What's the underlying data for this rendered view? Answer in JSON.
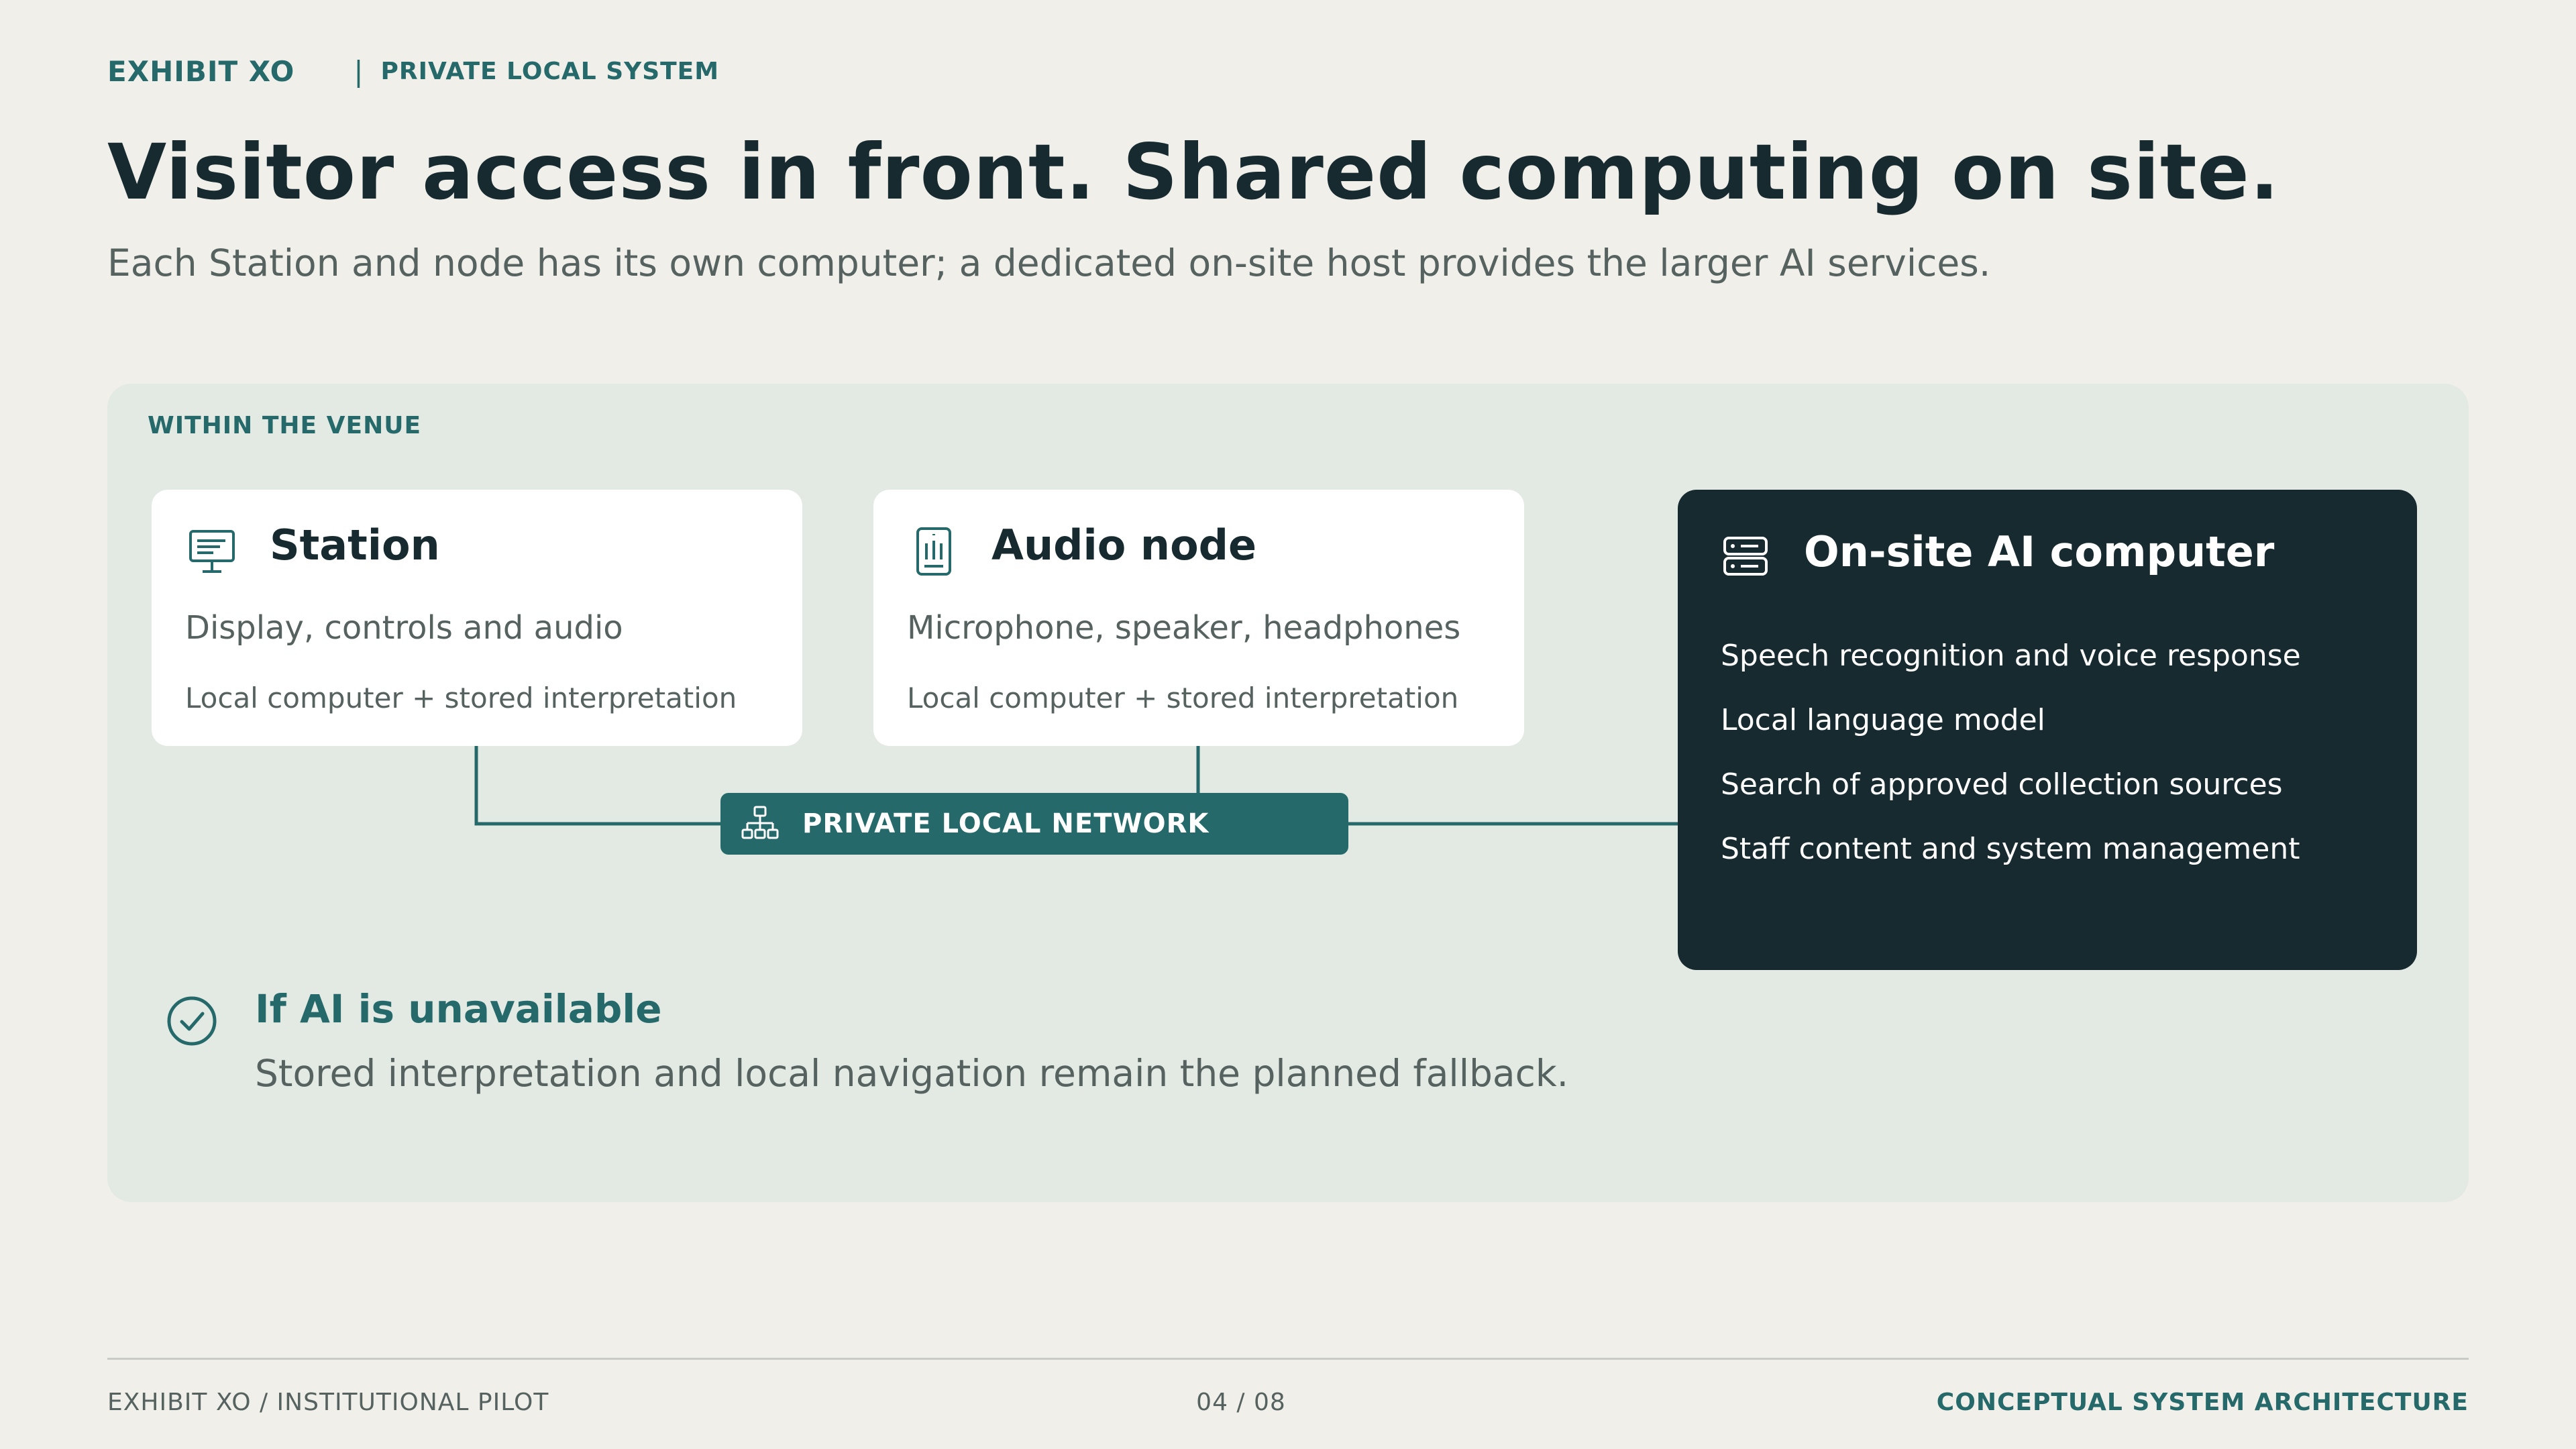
{
  "header": {
    "brand": "EXHIBIT XO",
    "separator": "|",
    "section": "PRIVATE LOCAL SYSTEM",
    "title": "Visitor access in front. Shared computing on site.",
    "subtitle": "Each Station and node has its own computer; a dedicated on-site host provides the larger AI services."
  },
  "venue": {
    "label": "WITHIN THE VENUE",
    "station": {
      "icon": "monitor-icon",
      "title": "Station",
      "description": "Display, controls and audio",
      "note": "Local computer + stored interpretation"
    },
    "audio_node": {
      "icon": "audio-device-icon",
      "title": "Audio node",
      "description": "Microphone, speaker, headphones",
      "note": "Local computer + stored interpretation"
    },
    "ai_computer": {
      "icon": "server-icon",
      "title": "On-site AI computer",
      "items": [
        "Speech recognition and voice response",
        "Local language model",
        "Search of approved collection sources",
        "Staff content and system management"
      ]
    },
    "network": {
      "icon": "network-icon",
      "label": "PRIVATE LOCAL NETWORK"
    },
    "fallback": {
      "icon": "check-circle-icon",
      "title": "If AI is unavailable",
      "text": "Stored interpretation and local navigation remain the planned fallback."
    }
  },
  "footer": {
    "left": "EXHIBIT XO  /  INSTITUTIONAL PILOT",
    "center": "04 / 08",
    "right": "CONCEPTUAL SYSTEM ARCHITECTURE"
  },
  "colors": {
    "background": "#f0efea",
    "panel": "#e3e9e3",
    "accent": "#25696a",
    "dark": "#172a30",
    "muted_text": "#56625f"
  }
}
